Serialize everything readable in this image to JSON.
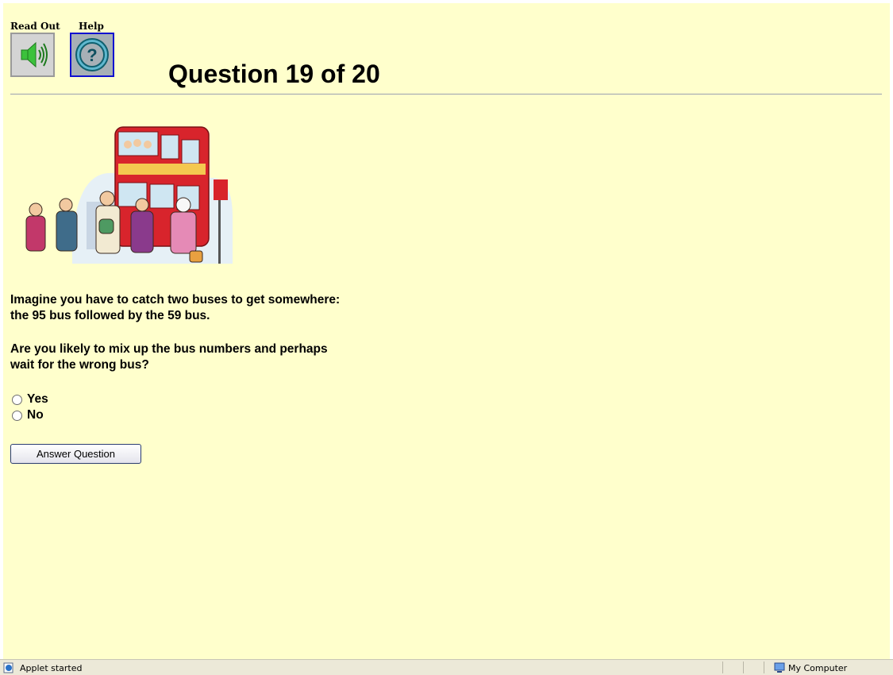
{
  "toolbar": {
    "read_out_label": "Read Out",
    "help_label": "Help",
    "read_out_icon": "speaker-icon",
    "help_icon": "question-mark-icon"
  },
  "header": {
    "title": "Question 19 of 20"
  },
  "question": {
    "lines": [
      "Imagine you have to catch two buses to get somewhere:",
      "the 95 bus followed by the 59 bus.",
      "Are you likely to mix up the bus numbers and perhaps",
      "wait for the wrong bus?"
    ],
    "illustration": "double-decker-bus-with-people-illustration",
    "options": [
      "Yes",
      "No"
    ],
    "submit_label": "Answer Question"
  },
  "statusbar": {
    "status": "Applet started",
    "zone": "My Computer"
  },
  "colors": {
    "page_background": "#ffffcc",
    "help_border": "#1010d0",
    "speaker_green": "#3cc23c",
    "help_teal": "#1a8aa8"
  }
}
